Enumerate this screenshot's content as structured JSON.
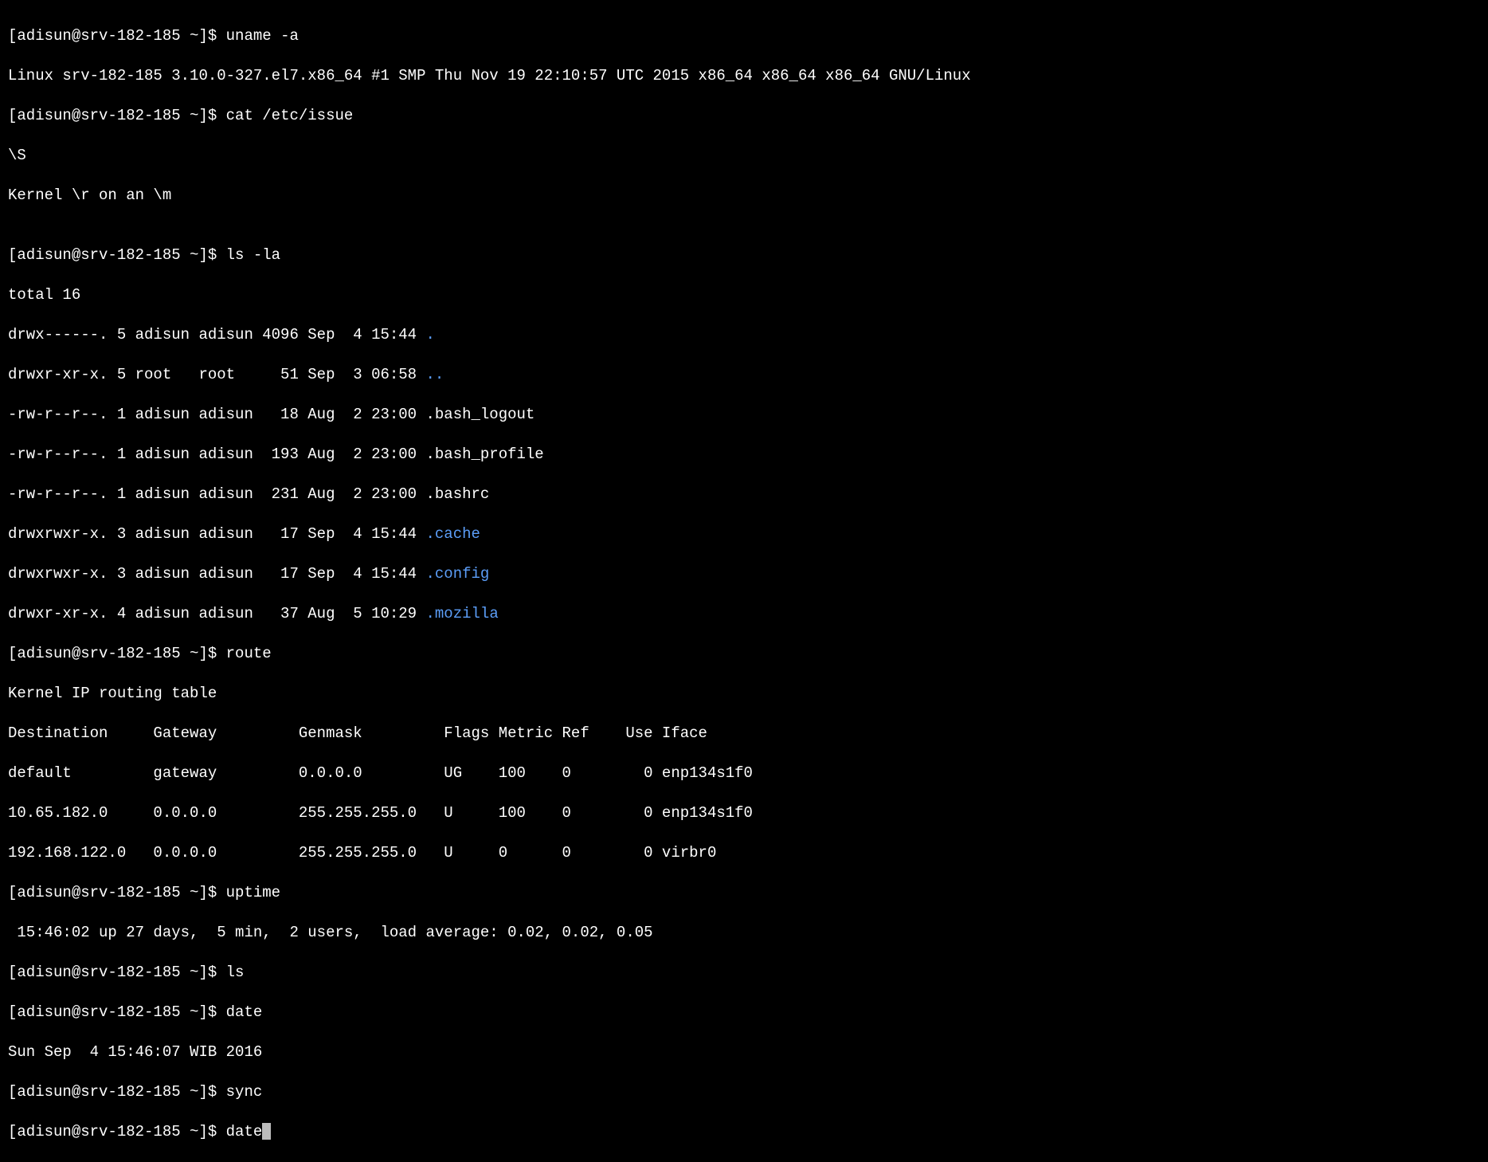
{
  "prompt": "[adisun@srv-182-185 ~]$ ",
  "cmd_uname": "uname -a",
  "out_uname": "Linux srv-182-185 3.10.0-327.el7.x86_64 #1 SMP Thu Nov 19 22:10:57 UTC 2015 x86_64 x86_64 x86_64 GNU/Linux",
  "cmd_cat": "cat /etc/issue",
  "out_cat1": "\\S",
  "out_cat2": "Kernel \\r on an \\m",
  "blank": "",
  "cmd_ls_la": "ls -la",
  "ls_total": "total 16",
  "ls_row1_pre": "drwx------. 5 adisun adisun 4096 Sep  4 15:44 ",
  "ls_row1_name": ".",
  "ls_row2_pre": "drwxr-xr-x. 5 root   root     51 Sep  3 06:58 ",
  "ls_row2_name": "..",
  "ls_row3": "-rw-r--r--. 1 adisun adisun   18 Aug  2 23:00 .bash_logout",
  "ls_row4": "-rw-r--r--. 1 adisun adisun  193 Aug  2 23:00 .bash_profile",
  "ls_row5": "-rw-r--r--. 1 adisun adisun  231 Aug  2 23:00 .bashrc",
  "ls_row6_pre": "drwxrwxr-x. 3 adisun adisun   17 Sep  4 15:44 ",
  "ls_row6_name": ".cache",
  "ls_row7_pre": "drwxrwxr-x. 3 adisun adisun   17 Sep  4 15:44 ",
  "ls_row7_name": ".config",
  "ls_row8_pre": "drwxr-xr-x. 4 adisun adisun   37 Aug  5 10:29 ",
  "ls_row8_name": ".mozilla",
  "cmd_route": "route",
  "route_title": "Kernel IP routing table",
  "route_head": "Destination     Gateway         Genmask         Flags Metric Ref    Use Iface",
  "route_r1": "default         gateway         0.0.0.0         UG    100    0        0 enp134s1f0",
  "route_r2": "10.65.182.0     0.0.0.0         255.255.255.0   U     100    0        0 enp134s1f0",
  "route_r3": "192.168.122.0   0.0.0.0         255.255.255.0   U     0      0        0 virbr0",
  "cmd_uptime": "uptime",
  "out_uptime": " 15:46:02 up 27 days,  5 min,  2 users,  load average: 0.02, 0.02, 0.05",
  "cmd_ls": "ls",
  "cmd_date": "date",
  "out_date": "Sun Sep  4 15:46:07 WIB 2016",
  "cmd_sync": "sync",
  "cmd_date2": "date"
}
